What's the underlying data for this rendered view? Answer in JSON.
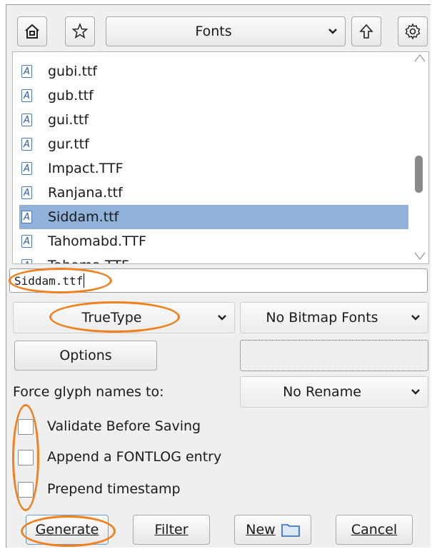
{
  "toolbar": {
    "home_icon": "home-icon",
    "bookmark_icon": "star-icon",
    "folder_select": "Fonts",
    "up_icon": "up-arrow-icon",
    "settings_icon": "gear-icon"
  },
  "file_list": {
    "items": [
      {
        "name": "gubi.ttf",
        "selected": false
      },
      {
        "name": "gub.ttf",
        "selected": false
      },
      {
        "name": "gui.ttf",
        "selected": false
      },
      {
        "name": "gur.ttf",
        "selected": false
      },
      {
        "name": "Impact.TTF",
        "selected": false
      },
      {
        "name": "Ranjana.ttf",
        "selected": false
      },
      {
        "name": "Siddam.ttf",
        "selected": true
      },
      {
        "name": "Tahomabd.TTF",
        "selected": false
      },
      {
        "name": "Tahoma.TTF",
        "selected": false
      }
    ],
    "file_icon_glyph": "A"
  },
  "filename_value": "Siddam.ttf",
  "format": {
    "outline_select": "TrueType",
    "bitmap_select": "No Bitmap Fonts"
  },
  "options_button": "Options",
  "glyph_names": {
    "label": "Force glyph names to:",
    "select": "No Rename"
  },
  "checkboxes": [
    {
      "label": "Validate Before Saving",
      "checked": false
    },
    {
      "label": "Append a FONTLOG entry",
      "checked": false
    },
    {
      "label": "Prepend timestamp",
      "checked": false
    }
  ],
  "buttons": {
    "generate": "Generate",
    "filter": "Filter",
    "new": "New",
    "cancel": "Cancel"
  },
  "annotation_color": "#f07f1d",
  "selection_color": "#8fb1da"
}
